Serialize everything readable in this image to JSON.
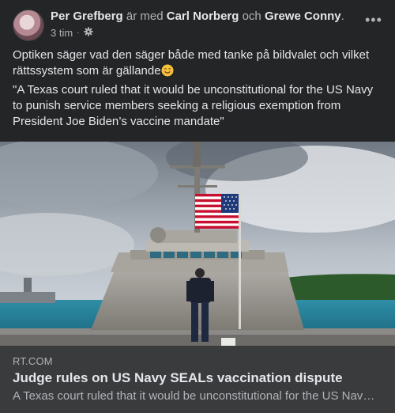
{
  "post": {
    "author": "Per Grefberg",
    "with_word": "är med",
    "tag1": "Carl Norberg",
    "and_word": "och",
    "tag2": "Grewe Conny",
    "period": ".",
    "time": "3 tim",
    "privacy_icon": "gear-icon",
    "more_icon": "more-options-icon",
    "more_label": "•••",
    "text_line1": "Optiken säger vad den säger både med tanke på bildvalet och vilket rättssystem som är gällande",
    "emoji": "smiling-face-emoji",
    "text_quote": "\"A Texas court ruled that it would be unconstitutional for the US Navy to punish service members seeking a religious exemption from President Joe Biden’s vaccine mandate\""
  },
  "link": {
    "domain": "RT.COM",
    "headline": "Judge rules on US Navy SEALs vaccination dispute",
    "description": "A Texas court ruled that it would be unconstitutional for the US Navy to punish service members seeking a religious exemption from President Joe Biden’s vaccine mandate"
  },
  "colors": {
    "card_bg": "#242526",
    "link_bg": "#3a3b3c",
    "text_primary": "#e4e6eb",
    "text_secondary": "#b0b3b8"
  }
}
